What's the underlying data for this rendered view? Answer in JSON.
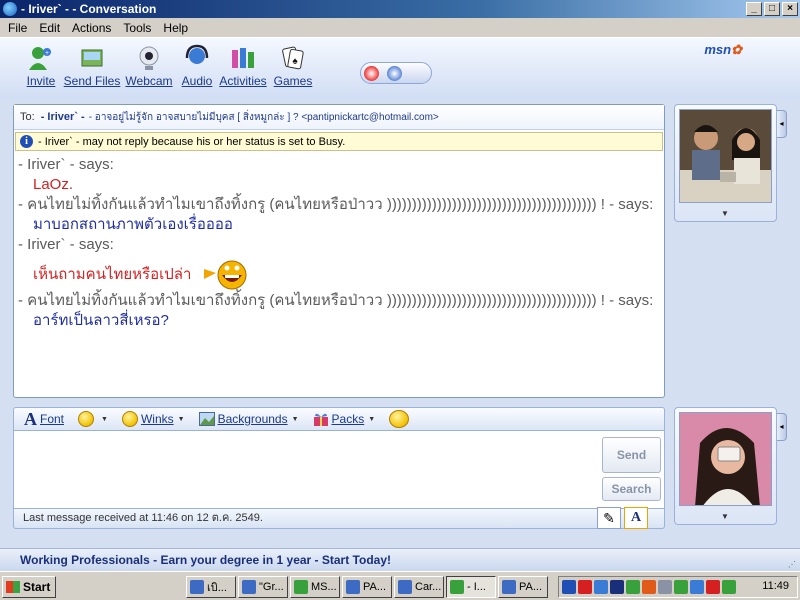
{
  "window": {
    "title": "- Iriver` - - Conversation"
  },
  "menu": [
    "File",
    "Edit",
    "Actions",
    "Tools",
    "Help"
  ],
  "toolbar": {
    "items": [
      {
        "label": "Invite",
        "icon": "invite-icon"
      },
      {
        "label": "Send Files",
        "icon": "send-files-icon"
      },
      {
        "label": "Webcam",
        "icon": "webcam-icon"
      },
      {
        "label": "Audio",
        "icon": "audio-icon"
      },
      {
        "label": "Activities",
        "icon": "activities-icon"
      },
      {
        "label": "Games",
        "icon": "games-icon"
      }
    ],
    "brand": "msn"
  },
  "conversation": {
    "to_label": "To:",
    "to_name": "- Iriver` -",
    "to_rest": "- อาจอยู่ไม่รู้จัก อาจสบายไม่มีบุคส [ สิ่งหมูกล่ะ ] ? <pantipnickartc@hotmail.com>",
    "info": "- Iriver` - may not reply because his or her status is set to Busy.",
    "messages": [
      {
        "header": "- Iriver` - says:",
        "body": "LaOz.",
        "color": "red"
      },
      {
        "header": "- คนไทยไม่ทิ้งกันแล้วทำไมเขาถึงทิ้งกรู (คนไทยหรือป่าวว )))))))))))))))))))))))))))))))))))))))))) ! - says:",
        "body": "มาบอกสถานภาพตัวเองเรื่ออออ",
        "color": "blue"
      },
      {
        "header": "- Iriver` - says:",
        "body": "เห็นถามคนไทยหรือเปล่า",
        "color": "red",
        "emoticon": true
      },
      {
        "header": "- คนไทยไม่ทิ้งกันแล้วทำไมเขาถึงทิ้งกรู (คนไทยหรือป่าวว )))))))))))))))))))))))))))))))))))))))))) ! - says:",
        "body": "อาร์ทเป็นลาวสี่เหรอ?",
        "color": "blue"
      }
    ]
  },
  "format_bar": {
    "font": "Font",
    "winks": "Winks",
    "backgrounds": "Backgrounds",
    "packs": "Packs"
  },
  "compose": {
    "send": "Send",
    "search": "Search",
    "status": "Last message received at 11:46 on 12 ต.ค. 2549."
  },
  "ad": "Working Professionals - Earn your degree in 1 year - Start Today!",
  "taskbar": {
    "start": "Start",
    "tasks": [
      "เบิ...",
      "\"Gr...",
      "MS...",
      "PA...",
      "Car...",
      "- I...",
      "PA..."
    ],
    "clock": "11:49"
  },
  "colors": {
    "message_red": "#d42020",
    "message_blue": "#1f2ea3",
    "title_bar": "#0a246a"
  }
}
